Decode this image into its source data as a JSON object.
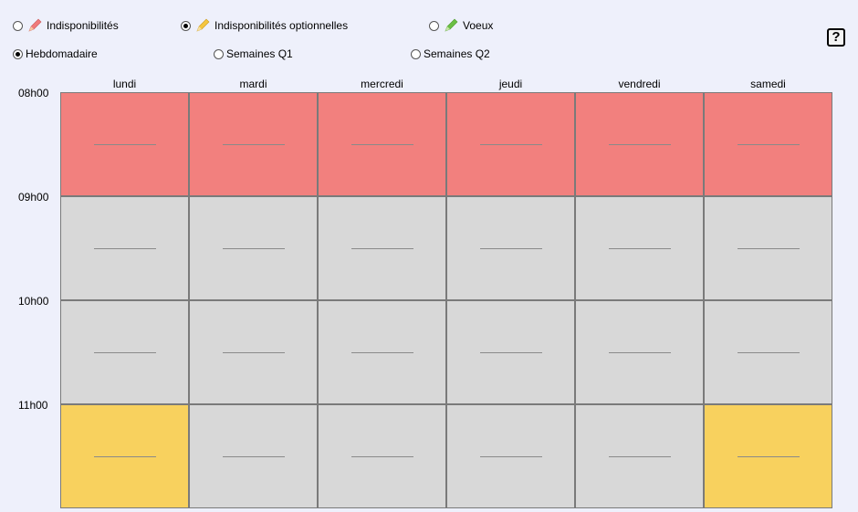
{
  "mode_options": [
    {
      "label": "Indisponibilités",
      "checked": false,
      "pencil_color": "#f07a7a"
    },
    {
      "label": "Indisponibilités optionnelles",
      "checked": true,
      "pencil_color": "#f5c640"
    },
    {
      "label": "Voeux",
      "checked": false,
      "pencil_color": "#6bbf44"
    }
  ],
  "week_options": [
    {
      "label": "Hebdomadaire",
      "checked": true
    },
    {
      "label": "Semaines Q1",
      "checked": false
    },
    {
      "label": "Semaines Q2",
      "checked": false
    }
  ],
  "help_label": "?",
  "days": [
    "lundi",
    "mardi",
    "mercredi",
    "jeudi",
    "vendredi",
    "samedi"
  ],
  "hours": [
    "08h00",
    "09h00",
    "10h00",
    "11h00"
  ],
  "colors": {
    "indisponible": "#f2807e",
    "libre": "#d8d8d8",
    "optionnel": "#f8d15e"
  },
  "slots": [
    [
      "indisponible",
      "indisponible",
      "indisponible",
      "indisponible",
      "indisponible",
      "indisponible"
    ],
    [
      "libre",
      "libre",
      "libre",
      "libre",
      "libre",
      "libre"
    ],
    [
      "libre",
      "libre",
      "libre",
      "libre",
      "libre",
      "libre"
    ],
    [
      "optionnel",
      "libre",
      "libre",
      "libre",
      "libre",
      "optionnel"
    ]
  ]
}
